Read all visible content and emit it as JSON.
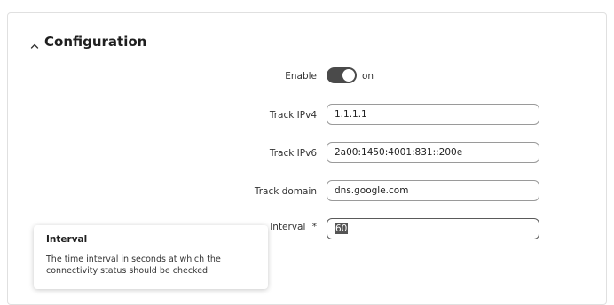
{
  "section": {
    "title": "Configuration",
    "icon": "chevron-up-icon"
  },
  "form": {
    "enable": {
      "label": "Enable",
      "state_text": "on",
      "value": true
    },
    "track_ipv4": {
      "label": "Track IPv4",
      "value": "1.1.1.1"
    },
    "track_ipv6": {
      "label": "Track IPv6",
      "value": "2a00:1450:4001:831::200e"
    },
    "track_domain": {
      "label": "Track domain",
      "value": "dns.google.com"
    },
    "interval": {
      "label": "Interval",
      "required_mark": "*",
      "value": "60"
    }
  },
  "tooltip": {
    "title": "Interval",
    "text": "The time interval in seconds at which the connectivity status should be checked"
  },
  "colors": {
    "toggle_on": "#4a4a4a",
    "selection": "#555555"
  }
}
